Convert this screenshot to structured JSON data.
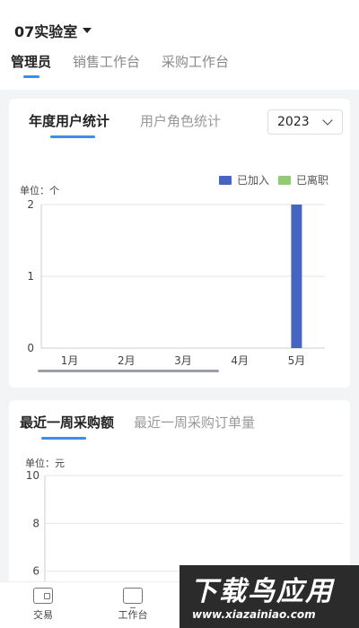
{
  "header": {
    "org_name": "07实验室",
    "role_tabs": [
      "管理员",
      "销售工作台",
      "采购工作台"
    ]
  },
  "user_stats": {
    "tabs": [
      "年度用户统计",
      "用户角色统计"
    ],
    "year": "2023",
    "unit": "单位：个"
  },
  "purchase": {
    "tabs": [
      "最近一周采购额",
      "最近一周采购订单量"
    ],
    "unit": "单位：元"
  },
  "bottom_nav": [
    "交易",
    "工作台"
  ],
  "watermark": {
    "main": "下载鸟应用",
    "sub": "www.xiazainiao.com"
  },
  "colors": {
    "accent": "#3a8ee6",
    "joined": "#4665c3",
    "left": "#91cc75"
  },
  "chart_data": [
    {
      "type": "bar",
      "categories": [
        "1月",
        "2月",
        "3月",
        "4月",
        "5月"
      ],
      "series": [
        {
          "name": "已加入",
          "values": [
            0,
            0,
            0,
            0,
            2
          ]
        },
        {
          "name": "已离职",
          "values": [
            0,
            0,
            0,
            0,
            0
          ]
        }
      ],
      "ylabel": "单位：个",
      "ylim": [
        0,
        2
      ],
      "yticks": [
        0,
        1,
        2
      ],
      "legend": "top-right",
      "grid": true
    },
    {
      "type": "line",
      "ylabel": "单位：元",
      "ylim": [
        4,
        10
      ],
      "yticks": [
        4,
        6,
        8,
        10
      ],
      "grid": true
    }
  ]
}
